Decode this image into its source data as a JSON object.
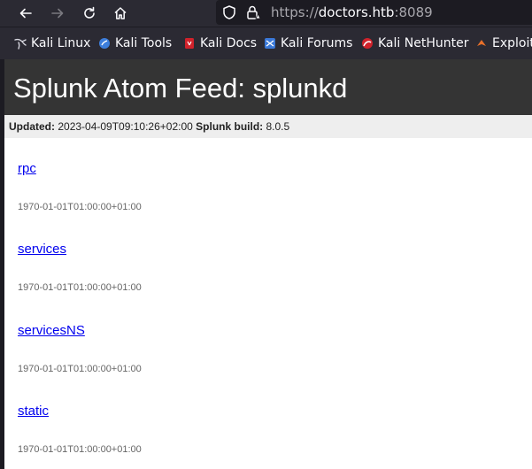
{
  "browser": {
    "url_scheme": "https://",
    "url_host": "doctors.htb",
    "url_port": ":8089"
  },
  "bookmarks": [
    {
      "label": "Kali Linux",
      "icon": "kali-dragon-icon"
    },
    {
      "label": "Kali Tools",
      "icon": "kali-tools-icon"
    },
    {
      "label": "Kali Docs",
      "icon": "kali-docs-icon"
    },
    {
      "label": "Kali Forums",
      "icon": "kali-forums-icon"
    },
    {
      "label": "Kali NetHunter",
      "icon": "kali-nethunter-icon"
    },
    {
      "label": "Exploit",
      "icon": "exploit-db-icon"
    }
  ],
  "feed": {
    "title": "Splunk Atom Feed: splunkd",
    "updated_label": "Updated:",
    "updated_value": "2023-04-09T09:10:26+02:00",
    "build_label": "Splunk build:",
    "build_value": "8.0.5"
  },
  "entries": [
    {
      "title": "rpc",
      "date": "1970-01-01T01:00:00+01:00"
    },
    {
      "title": "services",
      "date": "1970-01-01T01:00:00+01:00"
    },
    {
      "title": "servicesNS",
      "date": "1970-01-01T01:00:00+01:00"
    },
    {
      "title": "static",
      "date": "1970-01-01T01:00:00+01:00"
    }
  ],
  "colors": {
    "link": "#0000ee",
    "header_bg": "#343434",
    "toolbar_bg": "#2b2a33"
  }
}
